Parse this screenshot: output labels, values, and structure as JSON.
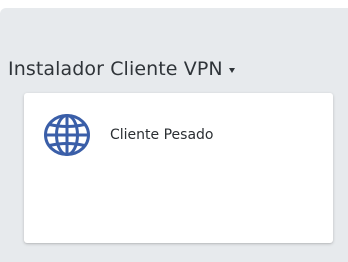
{
  "header": {
    "title": "Instalador Cliente VPN",
    "dropdown_icon": "caret-down-icon"
  },
  "card": {
    "items": [
      {
        "label": "Cliente Pesado",
        "icon": "globe-icon",
        "icon_color": "#3a5ea8"
      }
    ]
  },
  "colors": {
    "panel_background": "#e7eaed",
    "card_background": "#ffffff",
    "text": "#2f3439",
    "accent": "#3a5ea8"
  }
}
